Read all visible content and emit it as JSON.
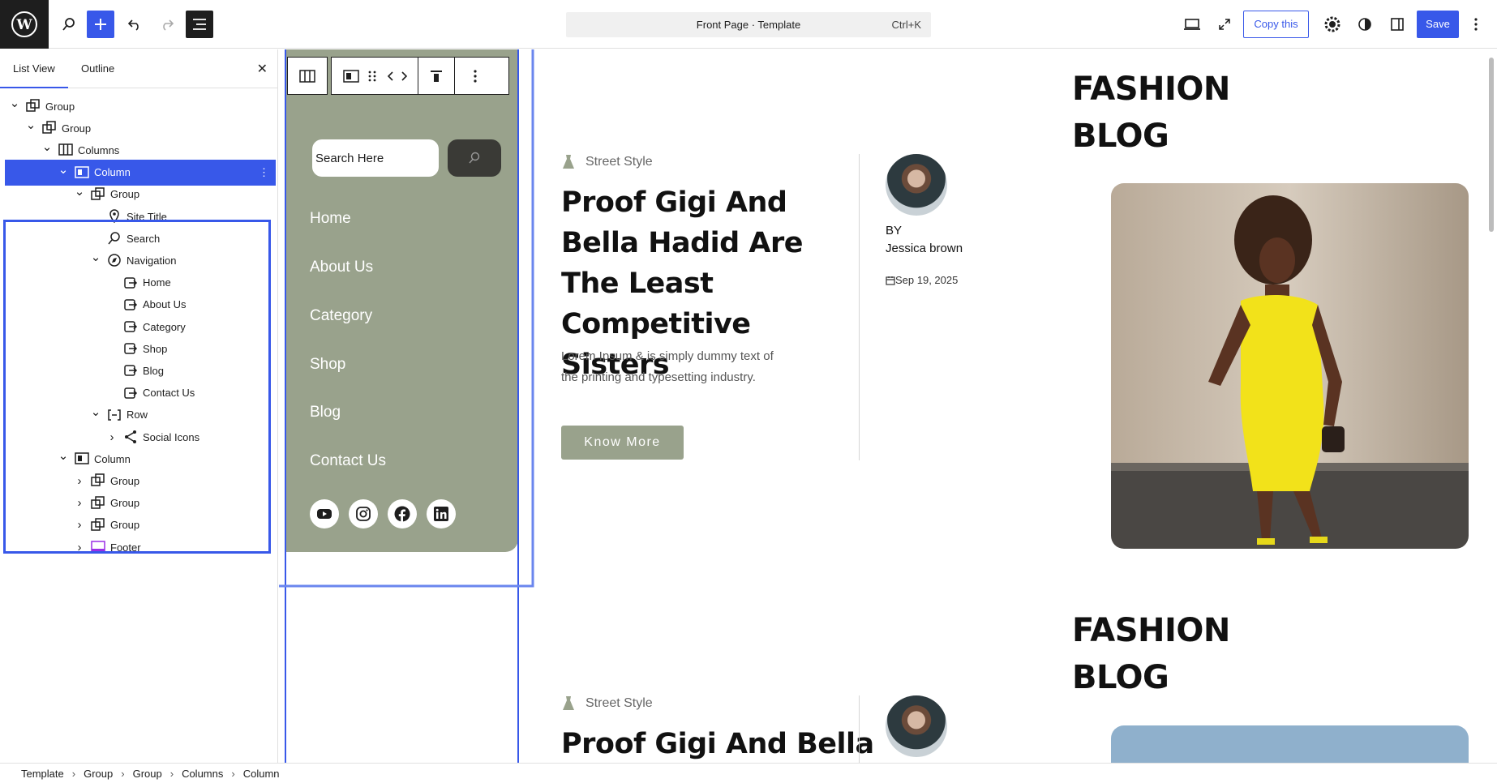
{
  "topbar": {
    "command_title": "Front Page · Template",
    "command_shortcut": "Ctrl+K",
    "copy_label": "Copy this",
    "save_label": "Save"
  },
  "sidebar": {
    "tabs": [
      "List View",
      "Outline"
    ],
    "tree": [
      {
        "label": "Group",
        "depth": 0,
        "icon": "group-icon",
        "expanded": true
      },
      {
        "label": "Group",
        "depth": 1,
        "icon": "group-icon",
        "expanded": true
      },
      {
        "label": "Columns",
        "depth": 2,
        "icon": "columns-icon",
        "expanded": true
      },
      {
        "label": "Column",
        "depth": 3,
        "icon": "column-icon",
        "expanded": true,
        "selected": true
      },
      {
        "label": "Group",
        "depth": 4,
        "icon": "group-icon",
        "expanded": true
      },
      {
        "label": "Site Title",
        "depth": 5,
        "icon": "map-pin-icon"
      },
      {
        "label": "Search",
        "depth": 5,
        "icon": "search-icon"
      },
      {
        "label": "Navigation",
        "depth": 5,
        "icon": "compass-icon",
        "expanded": true
      },
      {
        "label": "Home",
        "depth": 6,
        "icon": "link-icon"
      },
      {
        "label": "About Us",
        "depth": 6,
        "icon": "link-icon"
      },
      {
        "label": "Category",
        "depth": 6,
        "icon": "link-icon"
      },
      {
        "label": "Shop",
        "depth": 6,
        "icon": "link-icon"
      },
      {
        "label": "Blog",
        "depth": 6,
        "icon": "link-icon"
      },
      {
        "label": "Contact Us",
        "depth": 6,
        "icon": "link-icon"
      },
      {
        "label": "Row",
        "depth": 5,
        "icon": "row-icon",
        "expanded": true
      },
      {
        "label": "Social Icons",
        "depth": 6,
        "icon": "share-icon",
        "expanded": false
      },
      {
        "label": "Column",
        "depth": 3,
        "icon": "column-icon",
        "expanded": true
      },
      {
        "label": "Group",
        "depth": 4,
        "icon": "group-icon",
        "expanded": false
      },
      {
        "label": "Group",
        "depth": 4,
        "icon": "group-icon",
        "expanded": false
      },
      {
        "label": "Group",
        "depth": 4,
        "icon": "group-icon",
        "expanded": false
      },
      {
        "label": "Footer",
        "depth": 4,
        "icon": "footer-icon",
        "expanded": false
      }
    ]
  },
  "canvas": {
    "search_placeholder": "Search Here",
    "nav_items": [
      "Home",
      "About Us",
      "Category",
      "Shop",
      "Blog",
      "Contact Us"
    ],
    "social_icons": [
      "youtube-icon",
      "instagram-icon",
      "facebook-icon",
      "linkedin-icon"
    ],
    "posts": [
      {
        "category": "Street Style",
        "title": "Proof Gigi And Bella Hadid Are The Least Competitive Sisters",
        "excerpt": "Lorem Ipsum & is simply dummy text of the printing and typesetting industry.",
        "button": "Know More",
        "by": "BY",
        "author": "Jessica brown",
        "date": "Sep 19, 2025",
        "heading_line1": "FASHION",
        "heading_line2": "BLOG"
      },
      {
        "category": "Street Style",
        "title": "Proof Gigi And Bella",
        "heading_line1": "FASHION",
        "heading_line2": "BLOG"
      }
    ]
  },
  "breadcrumb": [
    "Template",
    "Group",
    "Group",
    "Columns",
    "Column"
  ],
  "colors": {
    "accent": "#3858e9",
    "sage": "#99a28c",
    "dark": "#1e1e1e",
    "dress": "#f2e21a"
  }
}
